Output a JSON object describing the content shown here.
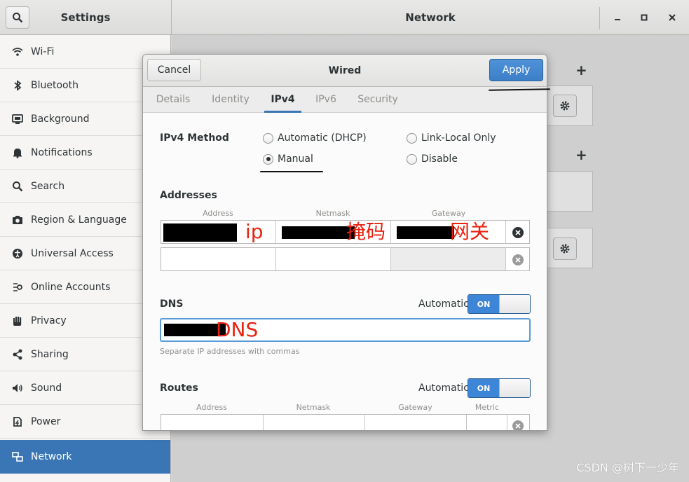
{
  "header": {
    "left_title": "Settings",
    "main_title": "Network",
    "window_controls": [
      "minimize-icon",
      "maximize-icon",
      "close-icon"
    ]
  },
  "sidebar": {
    "items": [
      {
        "label": "Wi-Fi",
        "icon": "wifi-icon"
      },
      {
        "label": "Bluetooth",
        "icon": "bluetooth-icon"
      },
      {
        "label": "Background",
        "icon": "background-icon"
      },
      {
        "label": "Notifications",
        "icon": "bell-icon"
      },
      {
        "label": "Search",
        "icon": "search-icon"
      },
      {
        "label": "Region & Language",
        "icon": "camera-icon"
      },
      {
        "label": "Universal Access",
        "icon": "accessibility-icon"
      },
      {
        "label": "Online Accounts",
        "icon": "accounts-icon"
      },
      {
        "label": "Privacy",
        "icon": "hand-icon"
      },
      {
        "label": "Sharing",
        "icon": "share-icon"
      },
      {
        "label": "Sound",
        "icon": "speaker-icon"
      },
      {
        "label": "Power",
        "icon": "power-icon"
      },
      {
        "label": "Network",
        "icon": "network-icon",
        "active": true
      }
    ]
  },
  "dialog": {
    "title": "Wired",
    "cancel_label": "Cancel",
    "apply_label": "Apply",
    "tabs": [
      "Details",
      "Identity",
      "IPv4",
      "IPv6",
      "Security"
    ],
    "active_tab": "IPv4",
    "ipv4_method": {
      "label": "IPv4 Method",
      "options": [
        "Automatic (DHCP)",
        "Link-Local Only",
        "Manual",
        "Disable"
      ],
      "selected": "Manual"
    },
    "addresses": {
      "label": "Addresses",
      "columns": [
        "Address",
        "Netmask",
        "Gateway"
      ],
      "annotations": [
        "ip",
        "掩码",
        "网关"
      ]
    },
    "dns": {
      "label": "DNS",
      "automatic_label": "Automatic",
      "toggle": "ON",
      "annotation": "DNS",
      "hint": "Separate IP addresses with commas"
    },
    "routes": {
      "label": "Routes",
      "automatic_label": "Automatic",
      "toggle": "ON",
      "columns": [
        "Address",
        "Netmask",
        "Gateway",
        "Metric"
      ]
    }
  },
  "watermark": "CSDN @树下一少年",
  "colors": {
    "accent": "#3a76b5",
    "annotation_red": "#e8220f"
  }
}
